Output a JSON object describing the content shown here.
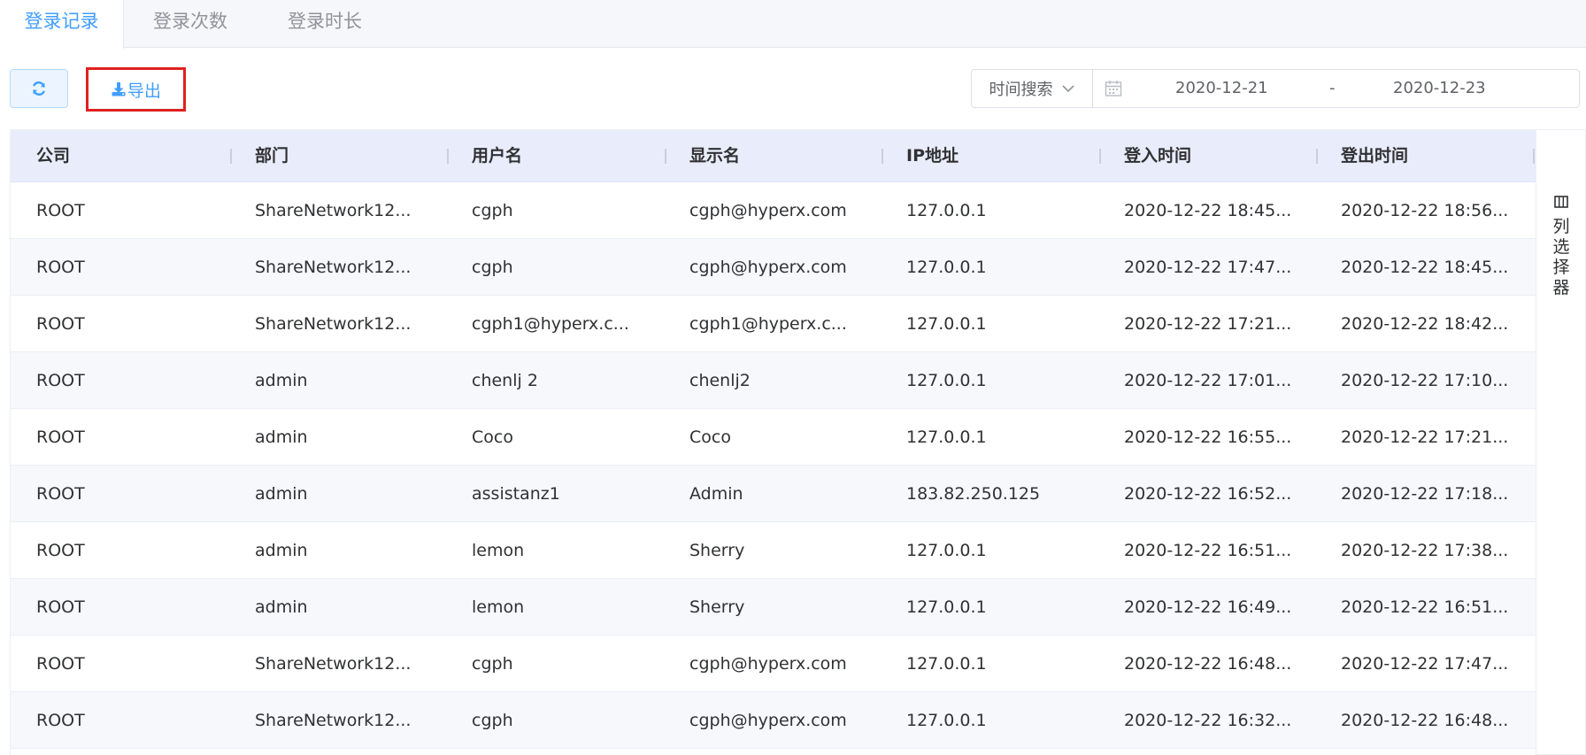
{
  "tabs": [
    {
      "label": "登录记录",
      "active": true
    },
    {
      "label": "登录次数",
      "active": false
    },
    {
      "label": "登录时长",
      "active": false
    }
  ],
  "toolbar": {
    "refresh_icon": "refresh-icon",
    "export_icon": "download-icon",
    "export_label": "导出"
  },
  "search": {
    "type_label": "时间搜索",
    "date_start": "2020-12-21",
    "date_separator": "-",
    "date_end": "2020-12-23"
  },
  "table": {
    "columns": [
      "公司",
      "部门",
      "用户名",
      "显示名",
      "IP地址",
      "登入时间",
      "登出时间"
    ],
    "rows": [
      [
        "ROOT",
        "ShareNetwork12...",
        "cgph",
        "cgph@hyperx.com",
        "127.0.0.1",
        "2020-12-22 18:45...",
        "2020-12-22 18:56..."
      ],
      [
        "ROOT",
        "ShareNetwork12...",
        "cgph",
        "cgph@hyperx.com",
        "127.0.0.1",
        "2020-12-22 17:47...",
        "2020-12-22 18:45..."
      ],
      [
        "ROOT",
        "ShareNetwork12...",
        "cgph1@hyperx.c...",
        "cgph1@hyperx.c...",
        "127.0.0.1",
        "2020-12-22 17:21...",
        "2020-12-22 18:42..."
      ],
      [
        "ROOT",
        "admin",
        "chenlj 2",
        "chenlj2",
        "127.0.0.1",
        "2020-12-22 17:01...",
        "2020-12-22 17:10..."
      ],
      [
        "ROOT",
        "admin",
        "Coco",
        "Coco",
        "127.0.0.1",
        "2020-12-22 16:55...",
        "2020-12-22 17:21..."
      ],
      [
        "ROOT",
        "admin",
        "assistanz1",
        "Admin",
        "183.82.250.125",
        "2020-12-22 16:52...",
        "2020-12-22 17:18..."
      ],
      [
        "ROOT",
        "admin",
        "lemon",
        "Sherry",
        "127.0.0.1",
        "2020-12-22 16:51...",
        "2020-12-22 17:38..."
      ],
      [
        "ROOT",
        "admin",
        "lemon",
        "Sherry",
        "127.0.0.1",
        "2020-12-22 16:49...",
        "2020-12-22 16:51..."
      ],
      [
        "ROOT",
        "ShareNetwork12...",
        "cgph",
        "cgph@hyperx.com",
        "127.0.0.1",
        "2020-12-22 16:48...",
        "2020-12-22 17:47..."
      ],
      [
        "ROOT",
        "ShareNetwork12...",
        "cgph",
        "cgph@hyperx.com",
        "127.0.0.1",
        "2020-12-22 16:32...",
        "2020-12-22 16:48..."
      ]
    ]
  },
  "column_selector": {
    "label": "列选择器",
    "icon": "columns-icon"
  },
  "colors": {
    "accent": "#409eff",
    "highlight_border": "#e02020",
    "header_bg": "#e9edfb"
  }
}
